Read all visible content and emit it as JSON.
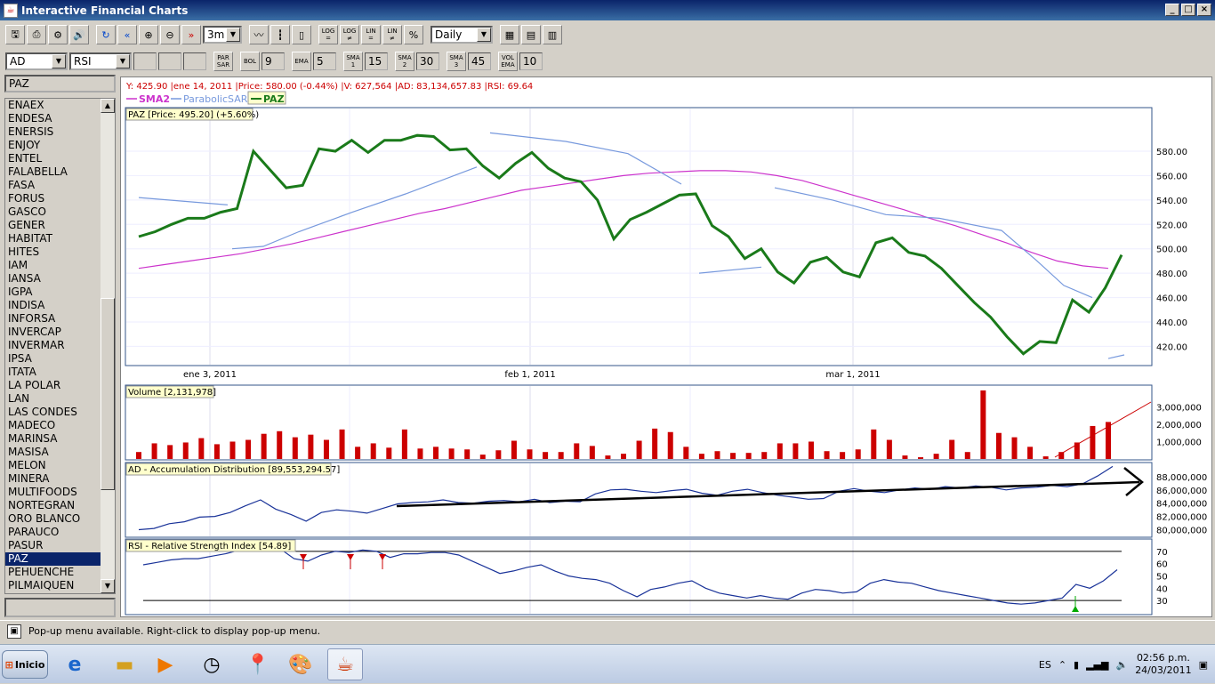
{
  "window": {
    "title": "Interactive Financial Charts"
  },
  "toolbar1": {
    "period": "3m",
    "interval": "Daily"
  },
  "toolbar2": {
    "indicator1": "AD",
    "indicator2": "RSI",
    "bol_val": "9",
    "ema_val": "5",
    "sma1_val": "15",
    "sma2_val": "30",
    "sma3_val": "45",
    "volema_val": "10"
  },
  "sidebar": {
    "symbol": "PAZ",
    "items": [
      "ENAEX",
      "ENDESA",
      "ENERSIS",
      "ENJOY",
      "ENTEL",
      "FALABELLA",
      "FASA",
      "FORUS",
      "GASCO",
      "GENER",
      "HABITAT",
      "HITES",
      "IAM",
      "IANSA",
      "IGPA",
      "INDISA",
      "INFORSA",
      "INVERCAP",
      "INVERMAR",
      "IPSA",
      "ITATA",
      "LA POLAR",
      "LAN",
      "LAS CONDES",
      "MADECO",
      "MARINSA",
      "MASISA",
      "MELON",
      "MINERA",
      "MULTIFOODS",
      "NORTEGRAN",
      "ORO BLANCO",
      "PARAUCO",
      "PASUR",
      "PAZ",
      "PEHUENCHE",
      "PILMAIQUEN"
    ],
    "selected": "PAZ"
  },
  "chart": {
    "info_line": "Y: 425.90 |ene 14, 2011 |Price: 580.00 (-0.44%) |V: 627,564 |AD: 83,134,657.83 |RSI: 69.64",
    "legend": {
      "sma2": "SMA2",
      "psar": "ParabolicSAR",
      "paz": "PAZ"
    },
    "price_panel_label": "PAZ [Price: 495.20] (+5.60%)",
    "volume_panel_label": "Volume [2,131,978]",
    "ad_panel_label": "AD - Accumulation Distribution [89,553,294.57]",
    "rsi_panel_label": "RSI - Relative Strength Index [54.89]",
    "date_labels": [
      "ene 3, 2011",
      "feb 1, 2011",
      "mar 1, 2011"
    ],
    "price_ticks": [
      "580.00",
      "560.00",
      "540.00",
      "520.00",
      "500.00",
      "480.00",
      "460.00",
      "440.00",
      "420.00"
    ],
    "volume_ticks": [
      "3,000,000",
      "2,000,000",
      "1,000,000"
    ],
    "ad_ticks": [
      "88,000,000",
      "86,000,000",
      "84,000,000",
      "82,000,000",
      "80,000,000"
    ],
    "rsi_ticks": [
      "70",
      "60",
      "50",
      "40",
      "30"
    ],
    "colors": {
      "price": "#1a7a1a",
      "sma2": "#cc33cc",
      "psar": "#7799dd",
      "volume": "#cc0000",
      "ad": "#1a3399",
      "rsi": "#1a3399"
    }
  },
  "chart_data": {
    "type": "line",
    "price": [
      510,
      514,
      520,
      525,
      525,
      530,
      533,
      580,
      565,
      550,
      552,
      582,
      580,
      589,
      579,
      589,
      589,
      593,
      592,
      581,
      582,
      568,
      558,
      570,
      579,
      566,
      558,
      555,
      540,
      508,
      524,
      530,
      537,
      544,
      545,
      519,
      510,
      492,
      500,
      481,
      472,
      489,
      493,
      481,
      477,
      505,
      509,
      497,
      494,
      484,
      470,
      456,
      444,
      428,
      414,
      424,
      423,
      458,
      448,
      468,
      495
    ],
    "sma2": [
      484,
      487,
      490,
      493,
      496,
      500,
      504,
      509,
      514,
      519,
      524,
      529,
      533,
      538,
      543,
      548,
      551,
      554,
      557,
      560,
      562,
      563,
      564,
      564,
      563,
      560,
      556,
      550,
      544,
      538,
      532,
      525,
      519,
      512,
      505,
      497,
      490,
      486,
      484
    ],
    "volume": [
      400000,
      900000,
      800000,
      950000,
      1200000,
      850000,
      1000000,
      1100000,
      1450000,
      1600000,
      1250000,
      1400000,
      1100000,
      1700000,
      700000,
      900000,
      650000,
      1700000,
      600000,
      700000,
      600000,
      550000,
      250000,
      500000,
      1050000,
      550000,
      400000,
      400000,
      900000,
      750000,
      200000,
      300000,
      1050000,
      1750000,
      1550000,
      700000,
      300000,
      450000,
      350000,
      350000,
      400000,
      900000,
      900000,
      1000000,
      450000,
      400000,
      550000,
      1700000,
      1100000,
      200000,
      100000,
      300000,
      1100000,
      400000,
      3950000,
      1500000,
      1250000,
      700000,
      150000,
      400000,
      950000,
      1900000,
      2131978
    ],
    "ad": [
      80.0,
      80.2,
      80.9,
      81.2,
      81.9,
      82.0,
      82.6,
      83.6,
      84.5,
      83.1,
      82.3,
      81.3,
      82.6,
      83.0,
      82.8,
      82.5,
      83.2,
      83.9,
      84.1,
      84.2,
      84.5,
      84.1,
      84.0,
      84.3,
      84.4,
      84.2,
      84.6,
      84.1,
      84.3,
      84.2,
      85.4,
      86.0,
      86.1,
      85.8,
      85.6,
      85.9,
      86.1,
      85.5,
      85.2,
      85.8,
      86.1,
      85.6,
      85.2,
      84.9,
      84.6,
      84.7,
      85.8,
      86.2,
      85.8,
      85.6,
      86.0,
      86.3,
      86.1,
      86.5,
      86.3,
      86.6,
      86.4,
      86.0,
      86.3,
      86.4,
      86.7,
      86.5,
      86.9,
      88.1,
      89.55
    ],
    "rsi": [
      59,
      61,
      63,
      64,
      64,
      66,
      68,
      71,
      74,
      79,
      72,
      64,
      62,
      67,
      70,
      69,
      71,
      70,
      65,
      68,
      68,
      69,
      69,
      67,
      62,
      57,
      52,
      54,
      57,
      59,
      54,
      50,
      48,
      47,
      44,
      38,
      33,
      39,
      41,
      44,
      46,
      40,
      36,
      34,
      32,
      34,
      32,
      31,
      36,
      39,
      38,
      36,
      37,
      44,
      47,
      45,
      44,
      41,
      38,
      36,
      34,
      32,
      30,
      28,
      27,
      28,
      30,
      32,
      43,
      40,
      46,
      55
    ],
    "xlabel": "",
    "ylabel": ""
  }
}
